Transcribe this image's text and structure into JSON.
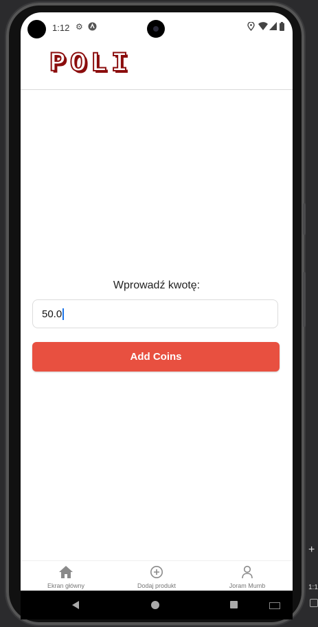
{
  "status_bar": {
    "time": "1:12",
    "icons": [
      "settings-icon",
      "android-icon",
      "location-icon",
      "wifi-icon",
      "signal-icon",
      "battery-icon"
    ]
  },
  "header": {
    "logo_text": "POLI",
    "logo_color": "#8b0d0d"
  },
  "form": {
    "prompt_label": "Wprowadź kwotę:",
    "amount_value": "50.0",
    "submit_label": "Add Coins",
    "button_color": "#e85040"
  },
  "tabbar": {
    "tabs": [
      {
        "label": "Ekran główny",
        "icon": "home-icon"
      },
      {
        "label": "Dodaj produkt",
        "icon": "add-circle-icon"
      },
      {
        "label": "Joram Mumb",
        "icon": "user-icon"
      }
    ]
  },
  "emulator": {
    "side_plus": "+",
    "side_ratio": "1:1"
  }
}
